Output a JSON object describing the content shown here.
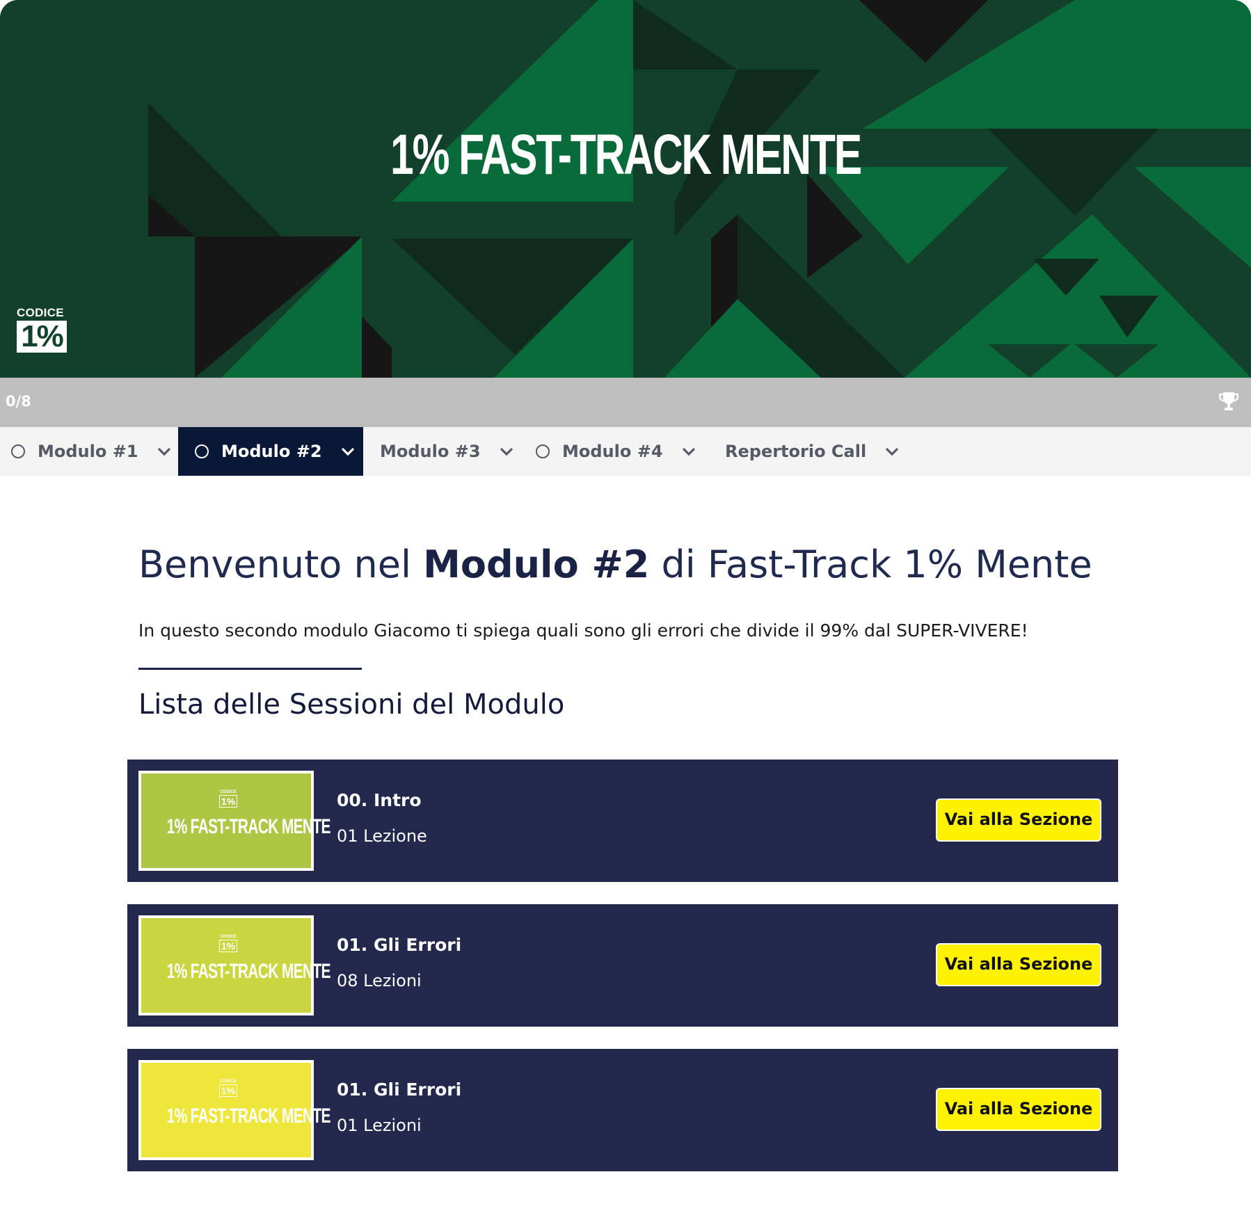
{
  "hero": {
    "title": "1% FAST-TRACK MENTE",
    "logo_top": "CODICE",
    "logo_box": "1%"
  },
  "progress": {
    "text": "0/8",
    "value": 0,
    "fill_color": "#2a9d5a",
    "icon": "trophy-icon"
  },
  "tabs": [
    {
      "label": "Modulo #1",
      "has_circle": true,
      "active": false
    },
    {
      "label": "Modulo #2",
      "has_circle": true,
      "active": true
    },
    {
      "label": "Modulo #3",
      "has_circle": false,
      "active": false
    },
    {
      "label": "Modulo #4",
      "has_circle": true,
      "active": false
    },
    {
      "label": "Repertorio Call",
      "has_circle": false,
      "active": false
    }
  ],
  "main": {
    "heading_pre": "Benvenuto nel ",
    "heading_bold": "Modulo #2",
    "heading_post": " di Fast-Track 1% Mente",
    "intro": "In questo secondo modulo Giacomo ti spiega quali sono gli errori che divide il 99% dal SUPER-VIVERE!",
    "list_title": "Lista delle Sessioni del Modulo"
  },
  "sessions": [
    {
      "thumb_logo_top": "CODICE",
      "thumb_logo_box": "1%",
      "thumb_title": "1% FAST-TRACK MENTE",
      "thumb_color": "#adc745",
      "title": "00. Intro",
      "count": "01 Lezione",
      "button": "Vai alla Sezione"
    },
    {
      "thumb_logo_top": "CODICE",
      "thumb_logo_box": "1%",
      "thumb_title": "1% FAST-TRACK MENTE",
      "thumb_color": "#c9d63f",
      "title": "01. Gli Errori",
      "count": "08 Lezioni",
      "button": "Vai alla Sezione"
    },
    {
      "thumb_logo_top": "CODICE",
      "thumb_logo_box": "1%",
      "thumb_title": "1% FAST-TRACK MENTE",
      "thumb_color": "#eee63b",
      "title": "01. Gli Errori",
      "count": "01 Lezioni",
      "button": "Vai alla Sezione"
    }
  ],
  "colors": {
    "nav_active_bg": "#0a1838",
    "card_bg": "#23284c",
    "button_bg": "#fff200",
    "hero_bg": "#12402a"
  }
}
